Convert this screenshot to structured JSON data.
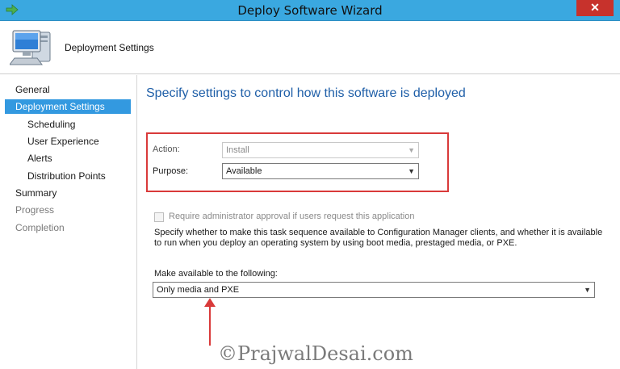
{
  "window": {
    "title": "Deploy Software Wizard",
    "close_label": "✕",
    "title_bar_color": "#3aa8e0"
  },
  "banner": {
    "title": "Deployment Settings",
    "icon": "computer-icon"
  },
  "nav": {
    "items": [
      {
        "label": "General",
        "state": "normal"
      },
      {
        "label": "Deployment Settings",
        "state": "active"
      },
      {
        "label": "Scheduling",
        "state": "normal"
      },
      {
        "label": "User Experience",
        "state": "normal"
      },
      {
        "label": "Alerts",
        "state": "normal"
      },
      {
        "label": "Distribution Points",
        "state": "normal"
      },
      {
        "label": "Summary",
        "state": "normal"
      },
      {
        "label": "Progress",
        "state": "dim"
      },
      {
        "label": "Completion",
        "state": "dim"
      }
    ]
  },
  "main": {
    "heading": "Specify settings to control how this software is deployed",
    "action_label": "Action:",
    "action_value": "Install",
    "purpose_label": "Purpose:",
    "purpose_value": "Available",
    "approval_label": "Require administrator approval if users request this application",
    "approval_checked": false,
    "description": "Specify whether to make this task sequence available to Configuration Manager clients, and whether it is available to run when you deploy an operating system by using boot media, prestaged media, or PXE.",
    "make_available_label": "Make available to the following:",
    "make_available_value": "Only media and PXE"
  },
  "watermark": "©PrajwalDesai.com",
  "colors": {
    "heading": "#1f5fa8",
    "highlight_box": "#d93a3a",
    "active_nav": "#3399e0"
  }
}
